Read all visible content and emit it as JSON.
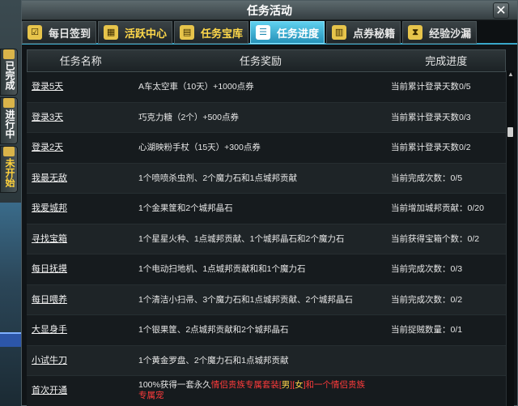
{
  "dialog": {
    "title": "任务活动",
    "close_label": "✕"
  },
  "tabs": [
    {
      "label": "每日签到",
      "icon": "checkbox-icon",
      "glyph": "☑"
    },
    {
      "label": "活跃中心",
      "icon": "calendar-icon",
      "glyph": "▦"
    },
    {
      "label": "任务宝库",
      "icon": "folder-icon",
      "glyph": "▤"
    },
    {
      "label": "任务进度",
      "icon": "progress-icon",
      "glyph": "☰"
    },
    {
      "label": "点券秘籍",
      "icon": "book-icon",
      "glyph": "▥"
    },
    {
      "label": "经验沙漏",
      "icon": "hourglass-icon",
      "glyph": "⧗"
    }
  ],
  "side_tabs": [
    {
      "label": "已完成"
    },
    {
      "label": "进行中"
    },
    {
      "label": "未开始"
    }
  ],
  "table": {
    "headers": [
      "任务名称",
      "任务奖励",
      "完成进度"
    ],
    "rows": [
      {
        "name": "登录5天",
        "reward": "A车太空車（10天）+1000点券",
        "progress": "当前累计登录天数0/5"
      },
      {
        "name": "登录3天",
        "reward": "巧克力糖（2个）+500点券",
        "progress": "当前累计登录天数0/3"
      },
      {
        "name": "登录2天",
        "reward": "心湖映粉手杖（15天）+300点券",
        "progress": "当前累计登录天数0/2"
      },
      {
        "name": "我最无敌",
        "reward": "1个喷喷杀虫剂、2个魔力石和1点城邦贡献",
        "progress": "当前完成次数：0/5"
      },
      {
        "name": "我爱城邦",
        "reward": "1个金果筐和2个城邦晶石",
        "progress": "当前增加城邦贡献：0/20"
      },
      {
        "name": "寻找宝箱",
        "reward": "1个星星火种、1点城邦贡献、1个城邦晶石和2个魔力石",
        "progress": "当前获得宝箱个数：0/2"
      },
      {
        "name": "每日抚摸",
        "reward": "1个电动扫地机、1点城邦贡献和和1个魔力石",
        "progress": "当前完成次数：0/3"
      },
      {
        "name": "每日喂养",
        "reward": "1个清洁小扫帚、3个魔力石和1点城邦贡献、2个城邦晶石",
        "progress": "当前完成次数：0/2"
      },
      {
        "name": "大显身手",
        "reward": "1个银果筐、2点城邦贡献和2个城邦晶石",
        "progress": "当前捉贼数量：0/1"
      },
      {
        "name": "小试牛刀",
        "reward": "1个黄金罗盘、2个魔力石和1点城邦贡献",
        "progress": ""
      }
    ],
    "last_row": {
      "name": "首次开通",
      "reward_prefix": "100%获得一套永久",
      "reward_red1": "情侣贵族专属套装[",
      "reward_gold1": "男",
      "reward_sep1": "][",
      "reward_gold2": "女",
      "reward_red2": "]和一个情侣贵族",
      "reward_red3": "专属宠",
      "progress": ""
    }
  },
  "colors": {
    "accent": "#39a7c9",
    "selected_tab": "#2591b8",
    "highlight": "#ff3b3b"
  }
}
